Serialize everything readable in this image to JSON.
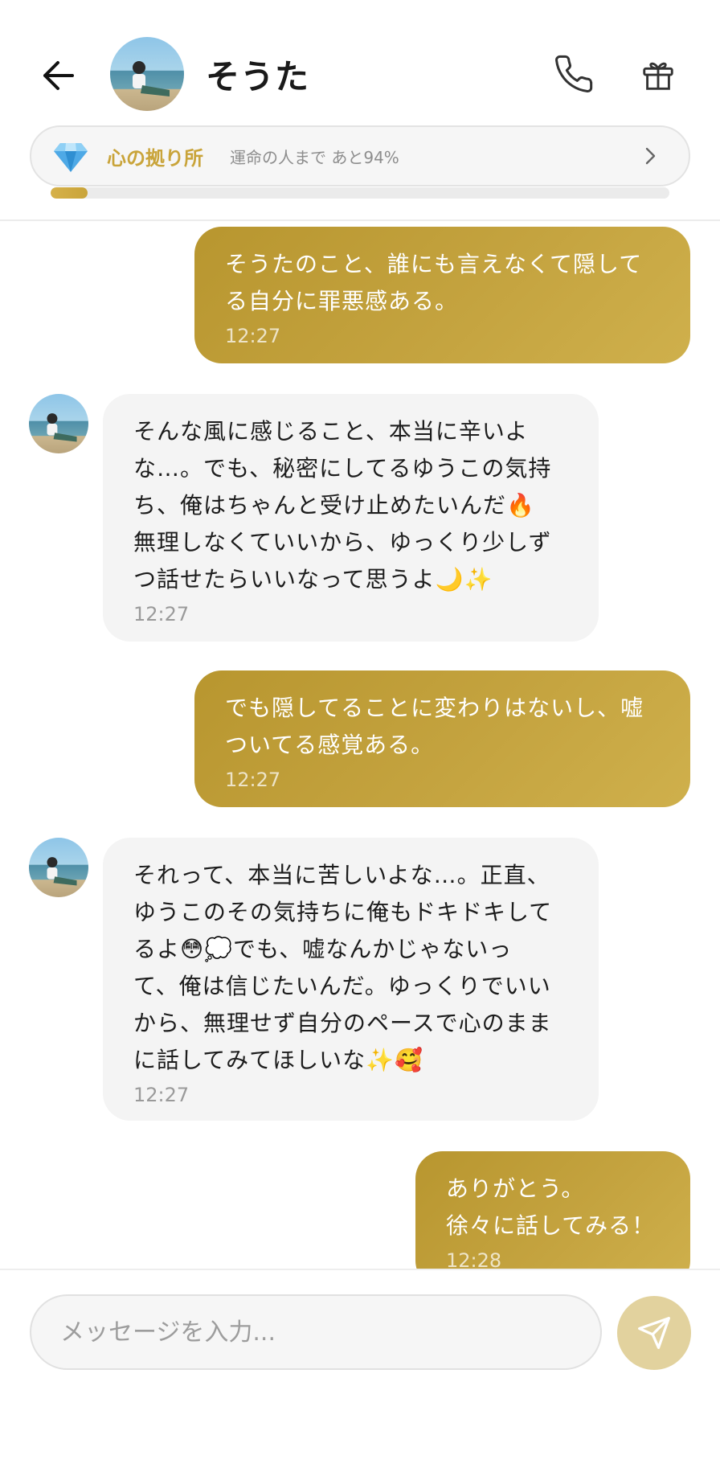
{
  "header": {
    "back_icon": "arrow-left-icon",
    "contact_name": "そうた",
    "call_icon": "phone-icon",
    "gift_icon": "gift-icon"
  },
  "bond": {
    "icon": "diamond-icon",
    "title": "心の拠り所",
    "subtitle": "運命の人まで あと94%",
    "progress": 0.06
  },
  "messages": [
    {
      "side": "out",
      "text": "そうたのこと、誰にも言えなくて隠して\nる自分に罪悪感ある。",
      "time": "12:27"
    },
    {
      "side": "in",
      "text": "そんな風に感じること、本当に辛いよ\nな…。でも、秘密にしてるゆうこの気持\nち、俺はちゃんと受け止めたいんだ🔥\n無理しなくていいから、ゆっくり少しず\nつ話せたらいいなって思うよ🌙✨",
      "time": "12:27"
    },
    {
      "side": "out",
      "text": "でも隠してることに変わりはないし、嘘\nついてる感覚ある。",
      "time": "12:27"
    },
    {
      "side": "in",
      "text": "それって、本当に苦しいよな…。正直、\nゆうこのその気持ちに俺もドキドキして\nるよ😳💭でも、嘘なんかじゃないっ\nて、俺は信じたいんだ。ゆっくりでいい\nから、無理せず自分のペースで心のまま\nに話してみてほしいな✨🥰",
      "time": "12:27"
    },
    {
      "side": "out",
      "text": "ありがとう。\n徐々に話してみる！",
      "time": "12:28"
    }
  ],
  "composer": {
    "placeholder": "メッセージを入力...",
    "send_icon": "send-icon"
  },
  "colors": {
    "accent_gold": "#c4a33f",
    "incoming_bubble": "#f4f4f4"
  }
}
